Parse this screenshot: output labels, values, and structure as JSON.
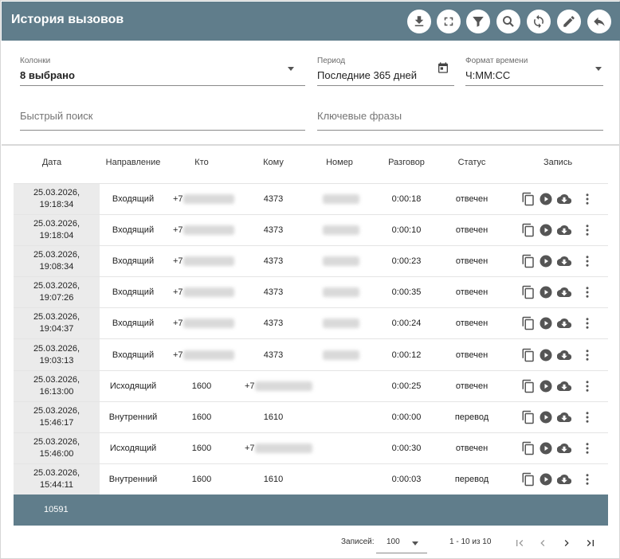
{
  "header": {
    "title": "История вызовов",
    "buttons": [
      "download-icon",
      "fullscreen-icon",
      "filter-icon",
      "zoom-search-icon",
      "refresh-icon",
      "edit-icon",
      "back-icon"
    ]
  },
  "filters": {
    "columns": {
      "label": "Колонки",
      "value": "8 выбрано"
    },
    "period": {
      "label": "Период",
      "value": "Последние 365 дней"
    },
    "time_format": {
      "label": "Формат времени",
      "value": "Ч:ММ:СС"
    },
    "quick_search": {
      "placeholder": "Быстрый поиск"
    },
    "keywords": {
      "placeholder": "Ключевые фразы"
    }
  },
  "table": {
    "columns": [
      "Дата",
      "Направление",
      "Кто",
      "Кому",
      "Номер",
      "Разговор",
      "Статус",
      "Запись"
    ],
    "rows": [
      {
        "date": "25.03.2026,",
        "time": "19:18:34",
        "direction": "Входящий",
        "who": "+7",
        "to": "4373",
        "duration": "0:00:18",
        "status": "отвечен"
      },
      {
        "date": "25.03.2026,",
        "time": "19:18:04",
        "direction": "Входящий",
        "who": "+7",
        "to": "4373",
        "duration": "0:00:10",
        "status": "отвечен"
      },
      {
        "date": "25.03.2026,",
        "time": "19:08:34",
        "direction": "Входящий",
        "who": "+7",
        "to": "4373",
        "duration": "0:00:23",
        "status": "отвечен"
      },
      {
        "date": "25.03.2026,",
        "time": "19:07:26",
        "direction": "Входящий",
        "who": "+7",
        "to": "4373",
        "duration": "0:00:35",
        "status": "отвечен"
      },
      {
        "date": "25.03.2026,",
        "time": "19:04:37",
        "direction": "Входящий",
        "who": "+7",
        "to": "4373",
        "duration": "0:00:24",
        "status": "отвечен"
      },
      {
        "date": "25.03.2026,",
        "time": "19:03:13",
        "direction": "Входящий",
        "who": "+7",
        "to": "4373",
        "duration": "0:00:12",
        "status": "отвечен"
      },
      {
        "date": "25.03.2026,",
        "time": "16:13:00",
        "direction": "Исходящий",
        "who": "1600",
        "to": "+7",
        "duration": "0:00:25",
        "status": "отвечен"
      },
      {
        "date": "25.03.2026,",
        "time": "15:46:17",
        "direction": "Внутренний",
        "who": "1600",
        "to": "1610",
        "duration": "0:00:00",
        "status": "перевод"
      },
      {
        "date": "25.03.2026,",
        "time": "15:46:00",
        "direction": "Исходящий",
        "who": "1600",
        "to": "+7",
        "duration": "0:00:30",
        "status": "отвечен"
      },
      {
        "date": "25.03.2026,",
        "time": "15:44:11",
        "direction": "Внутренний",
        "who": "1600",
        "to": "1610",
        "duration": "0:00:03",
        "status": "перевод"
      }
    ],
    "total": "10591"
  },
  "pager": {
    "label": "Записей:",
    "page_size": "100",
    "range": "1 - 10 из 10"
  },
  "colors": {
    "header": "#607d8b",
    "icon": "#555555"
  }
}
